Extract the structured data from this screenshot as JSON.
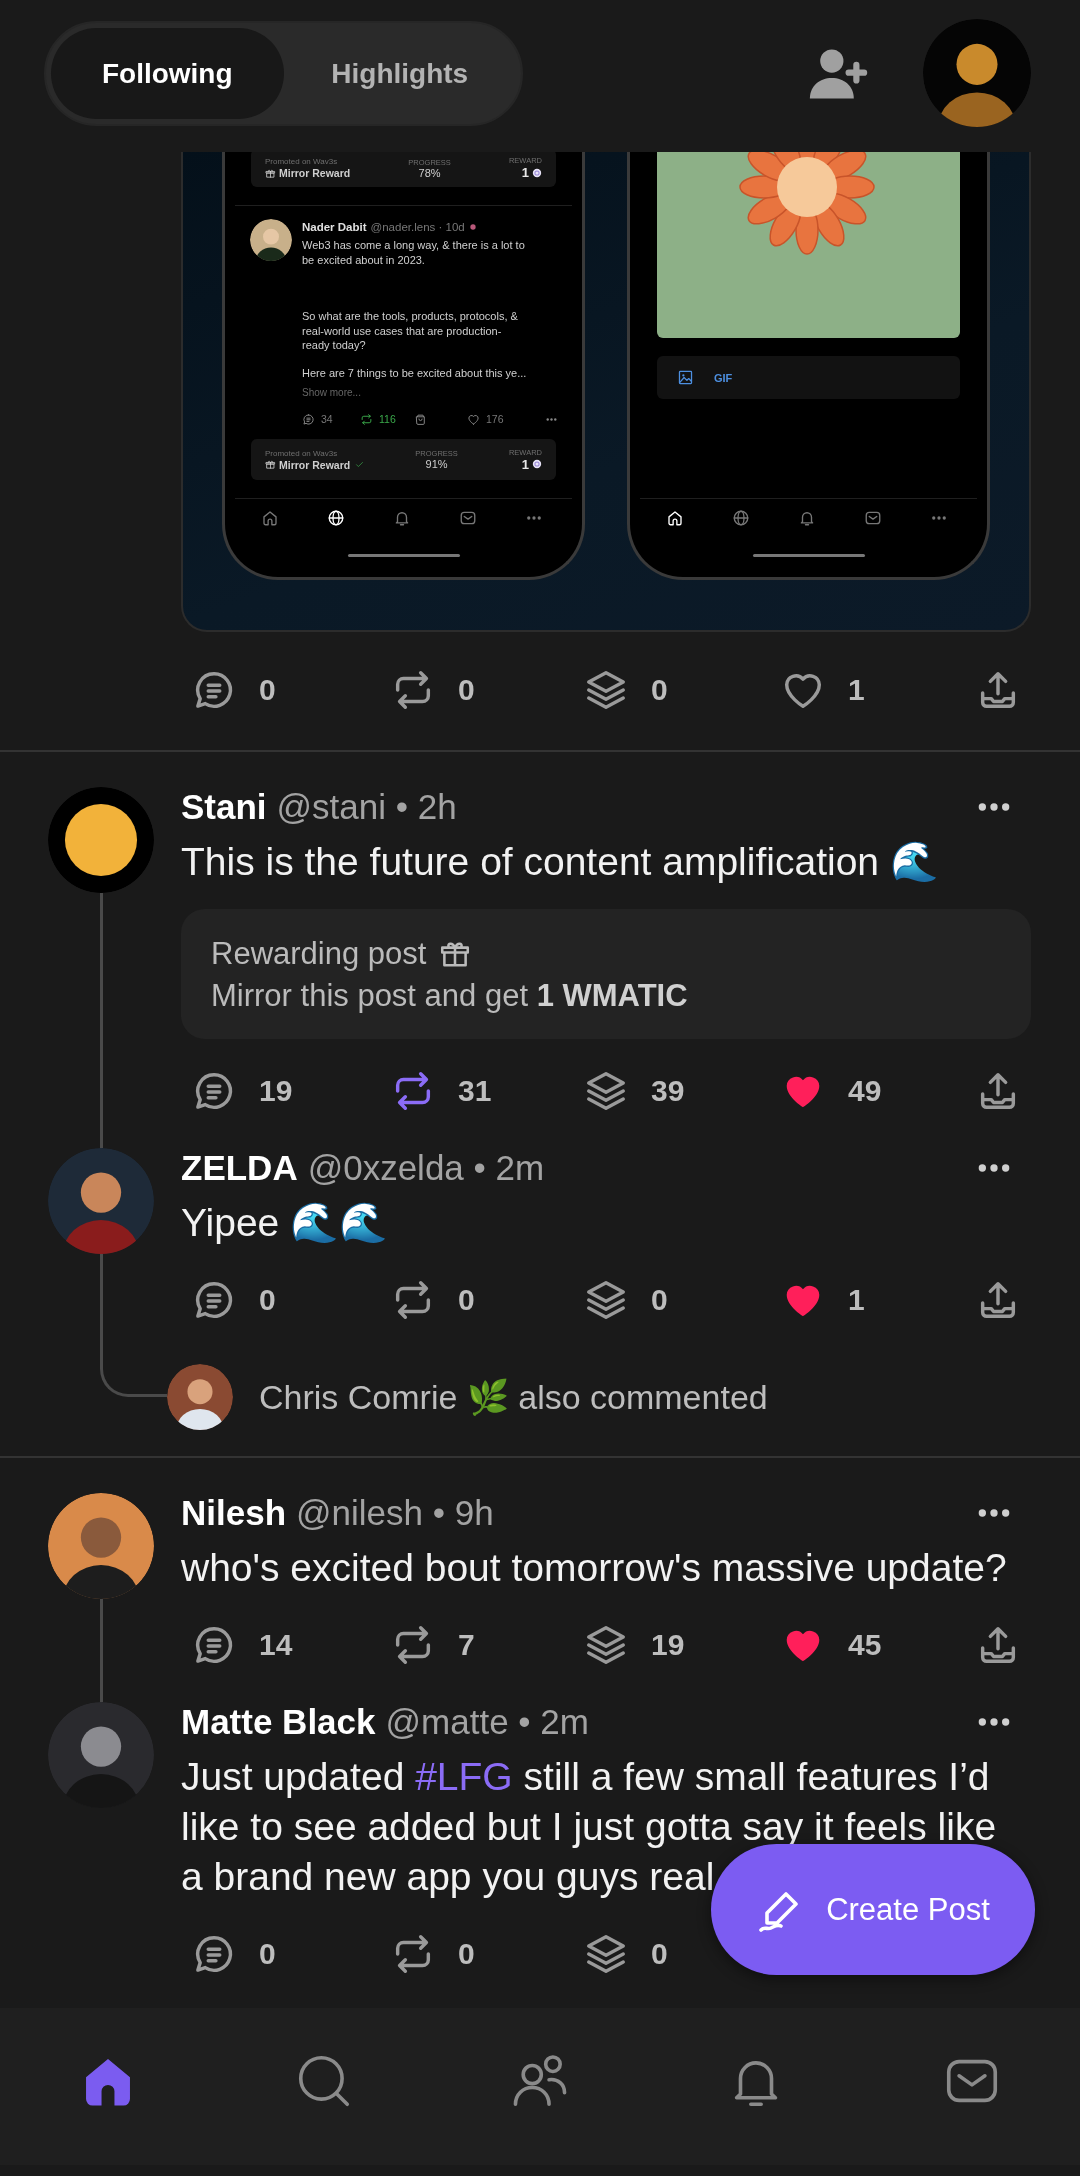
{
  "header": {
    "tabs": [
      {
        "label": "Following",
        "selected": true
      },
      {
        "label": "Highlights",
        "selected": false
      }
    ]
  },
  "feed": [
    {
      "kind": "media",
      "media": {
        "phones": [
          {
            "kind": "feed",
            "items": [
              {
                "kind": "promo",
                "source": "Promoted on Wav3s",
                "title": "Mirror Reward",
                "verified": false,
                "progress_label": "PROGRESS",
                "progress": "78%",
                "reward_label": "REWARD",
                "reward": "1"
              },
              {
                "kind": "post",
                "name": "Nader Dabit",
                "meta": "@nader.lens · 10d",
                "paragraphs": [
                  "Web3 has come a long way, & there is a lot to\nbe excited about in 2023.",
                  "So what are the tools, products, protocols, &\nreal-world use cases that are production-\nready today?",
                  "Here are 7 things to be excited about this ye..."
                ],
                "show_more": "Show more...",
                "actions": [
                  {
                    "kind": "comment",
                    "count": "34",
                    "active": false
                  },
                  {
                    "kind": "mirror",
                    "count": "116",
                    "active": true
                  },
                  {
                    "kind": "collect"
                  },
                  {
                    "kind": "like",
                    "count": "176",
                    "active": false
                  },
                  {
                    "kind": "more"
                  }
                ]
              },
              {
                "kind": "promo",
                "source": "Promoted on Wav3s",
                "title": "Mirror Reward",
                "verified": true,
                "progress_label": "PROGRESS",
                "progress": "91%",
                "reward_label": "REWARD",
                "reward": "1"
              }
            ],
            "nav": [
              {
                "kind": "home",
                "selected": false
              },
              {
                "kind": "globe",
                "selected": true
              },
              {
                "kind": "bell",
                "selected": false
              },
              {
                "kind": "mail",
                "selected": false
              },
              {
                "kind": "more",
                "selected": false
              }
            ]
          },
          {
            "kind": "compose",
            "toolbar": {
              "label": "GIF"
            },
            "nav": [
              {
                "kind": "home",
                "selected": true
              },
              {
                "kind": "globe",
                "selected": false
              },
              {
                "kind": "bell",
                "selected": false
              },
              {
                "kind": "mail",
                "selected": false
              },
              {
                "kind": "more",
                "selected": false
              }
            ]
          }
        ]
      },
      "actions": [
        {
          "kind": "comment",
          "count": "0",
          "active": false
        },
        {
          "kind": "mirror",
          "count": "0",
          "active": false
        },
        {
          "kind": "collect",
          "count": "0",
          "active": false
        },
        {
          "kind": "like",
          "count": "1",
          "active": false
        },
        {
          "kind": "share"
        }
      ]
    },
    {
      "kind": "thread",
      "posts": [
        {
          "name": "Stani",
          "meta": "@stani • 2h",
          "text": "This is the future of content amplification 🌊",
          "reward": {
            "title": "Rewarding post",
            "detail": "Mirror this post and get **1 WMATIC**"
          },
          "actions": [
            {
              "kind": "comment",
              "count": "19",
              "active": false
            },
            {
              "kind": "mirror",
              "count": "31",
              "active": true
            },
            {
              "kind": "collect",
              "count": "39",
              "active": false
            },
            {
              "kind": "like",
              "count": "49",
              "active": true
            },
            {
              "kind": "share"
            }
          ]
        },
        {
          "name": "ZELDA",
          "meta": "@0xzelda • 2m",
          "text": "Yipee 🌊🌊",
          "actions": [
            {
              "kind": "comment",
              "count": "0",
              "active": false
            },
            {
              "kind": "mirror",
              "count": "0",
              "active": false
            },
            {
              "kind": "collect",
              "count": "0",
              "active": false
            },
            {
              "kind": "like",
              "count": "1",
              "active": true
            },
            {
              "kind": "share"
            }
          ]
        }
      ],
      "also": {
        "text": "Chris Comrie 🌿 also commented"
      }
    },
    {
      "kind": "thread",
      "posts": [
        {
          "name": "Nilesh",
          "meta": "@nilesh • 9h",
          "text": "who's excited bout tomorrow's massive update?",
          "actions": [
            {
              "kind": "comment",
              "count": "14",
              "active": false
            },
            {
              "kind": "mirror",
              "count": "7",
              "active": false
            },
            {
              "kind": "collect",
              "count": "19",
              "active": false
            },
            {
              "kind": "like",
              "count": "45",
              "active": true
            },
            {
              "kind": "share"
            }
          ]
        },
        {
          "name": "Matte Black",
          "meta": "@matte • 2m",
          "segments": [
            {
              "kind": "text",
              "text": "Just updated "
            },
            {
              "kind": "hashtag",
              "text": "#LFG"
            },
            {
              "kind": "text",
              "text": " still a few small features I’d\nlike to see added but I just gotta say it feels like\na brand new app you guys real"
            }
          ],
          "actions": [
            {
              "kind": "comment",
              "count": "0",
              "active": false
            },
            {
              "kind": "mirror",
              "count": "0",
              "active": false
            },
            {
              "kind": "collect",
              "count": "0",
              "active": false
            }
          ]
        }
      ]
    }
  ],
  "fab": {
    "label": "Create Post"
  },
  "bottom_nav": [
    {
      "kind": "home",
      "selected": true
    },
    {
      "kind": "search",
      "selected": false
    },
    {
      "kind": "people",
      "selected": false
    },
    {
      "kind": "bell",
      "selected": false
    },
    {
      "kind": "mail",
      "selected": false
    }
  ]
}
